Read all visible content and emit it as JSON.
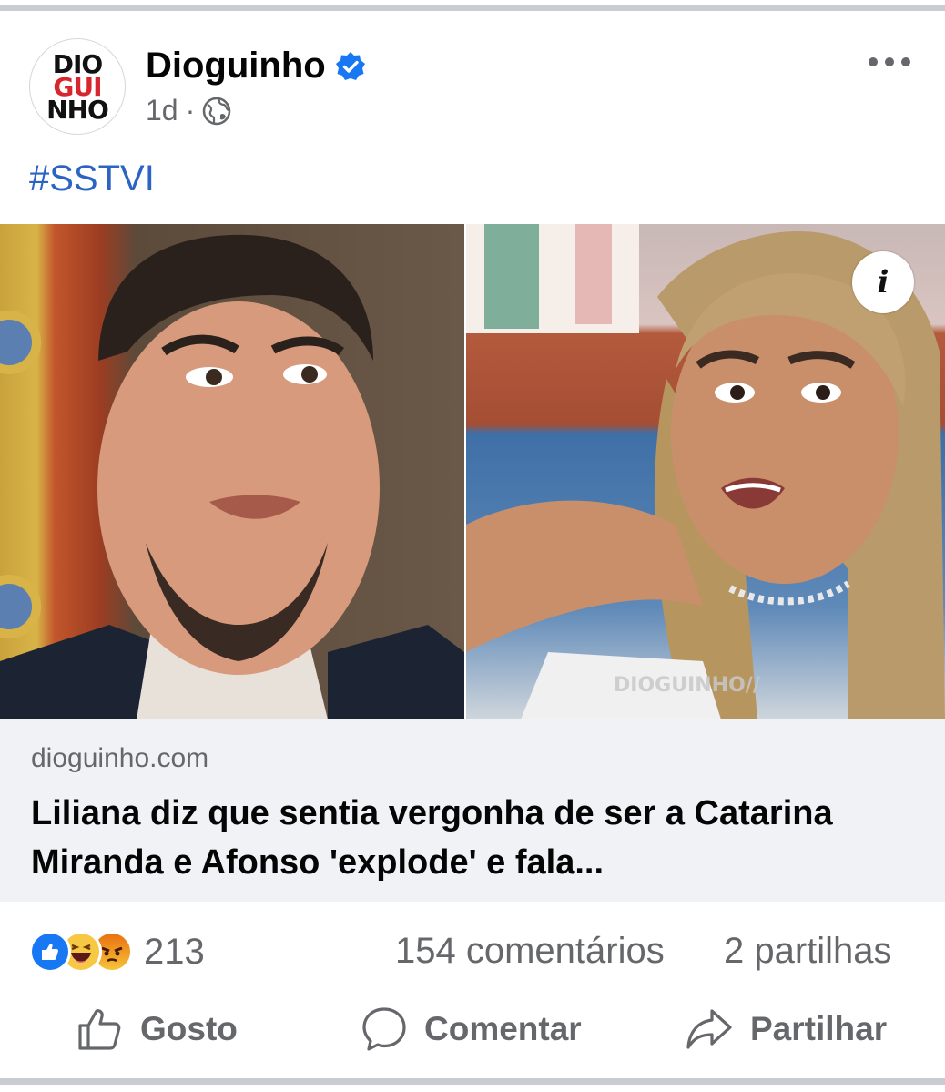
{
  "post": {
    "page_name": "Dioguinho",
    "logo": {
      "line1": "DIO",
      "line2": "GUI",
      "line3": "NHO"
    },
    "time": "1d",
    "separator": "·",
    "hashtag": "#SSTVI"
  },
  "media": {
    "info_symbol": "i",
    "watermark": "DIOGUINHO//"
  },
  "link_preview": {
    "domain": "dioguinho.com",
    "title": "Liliana diz que sentia vergonha de ser a Catarina Miranda e Afonso 'explode' e fala..."
  },
  "stats": {
    "reaction_icons": [
      "like-icon",
      "haha-icon",
      "angry-icon"
    ],
    "reaction_count": "213",
    "comments": "154 comentários",
    "shares": "2 partilhas"
  },
  "actions": {
    "like": "Gosto",
    "comment": "Comentar",
    "share": "Partilhar"
  },
  "colors": {
    "hashtag": "#2c64c4",
    "verified": "#1877f2",
    "secondary_text": "#65676b",
    "preview_bg": "#f0f2f5"
  }
}
